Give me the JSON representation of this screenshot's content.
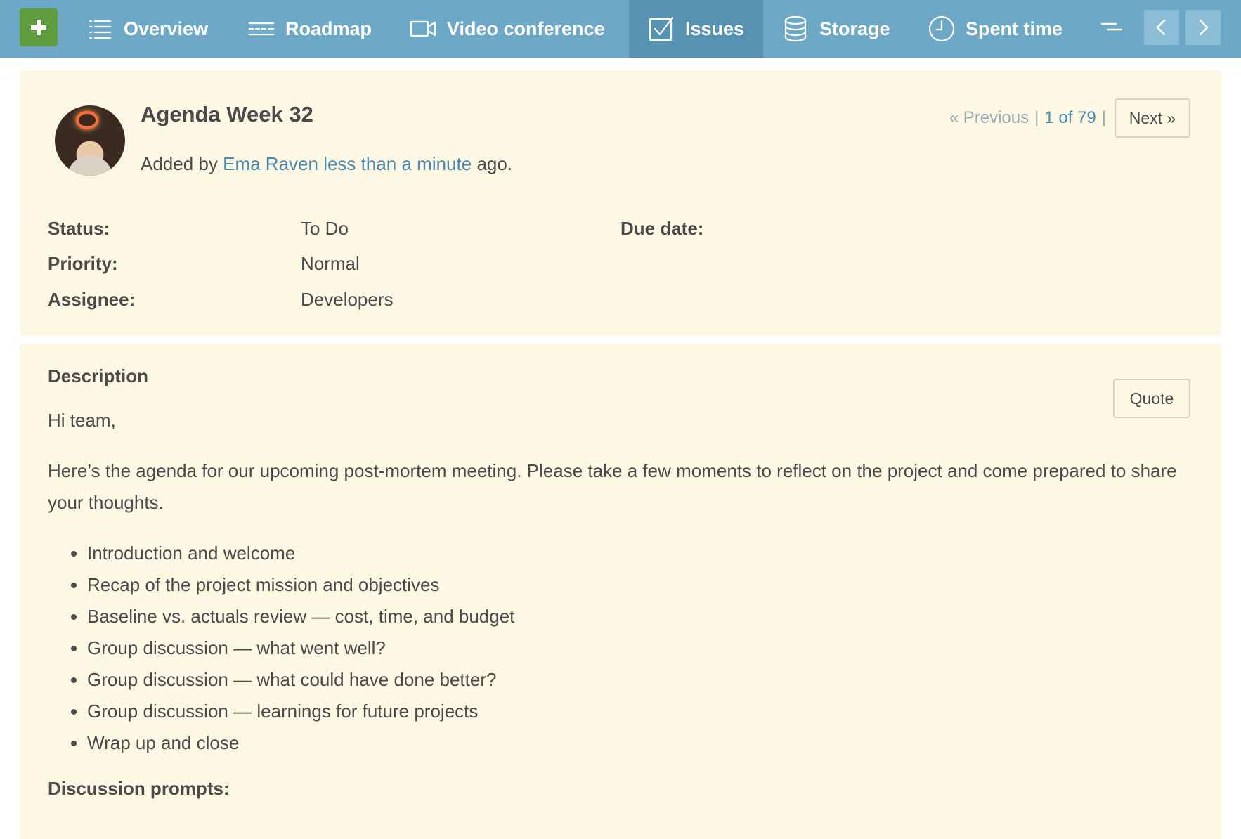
{
  "nav": {
    "new_icon": "plus-icon",
    "items": [
      {
        "label": "Overview",
        "icon": "list-icon",
        "active": false
      },
      {
        "label": "Roadmap",
        "icon": "roadmap-icon",
        "active": false
      },
      {
        "label": "Video conference",
        "icon": "video-camera-icon",
        "active": false
      },
      {
        "label": "Issues",
        "icon": "checkbox-icon",
        "active": true
      },
      {
        "label": "Storage",
        "icon": "database-icon",
        "active": false
      },
      {
        "label": "Spent time",
        "icon": "clock-icon",
        "active": false
      }
    ],
    "more_icon": "menu-more-icon",
    "prev_icon": "chevron-left-icon",
    "next_icon": "chevron-right-icon"
  },
  "issue": {
    "title": "Agenda Week 32",
    "added_prefix": "Added by",
    "author": "Ema Raven",
    "time_ago": "less than a minute",
    "added_suffix": "ago."
  },
  "pager": {
    "previous": "« Previous",
    "separator": "|",
    "position": "1 of 79",
    "next": "Next »"
  },
  "attributes": {
    "status_label": "Status:",
    "status_value": "To Do",
    "priority_label": "Priority:",
    "priority_value": "Normal",
    "assignee_label": "Assignee:",
    "assignee_value": "Developers",
    "due_date_label": "Due date:",
    "due_date_value": ""
  },
  "description": {
    "heading": "Description",
    "quote_button": "Quote",
    "greeting": "Hi team,",
    "intro": "Here’s the agenda for our upcoming post-mortem meeting. Please take a few moments to reflect on the project and come prepared to share your thoughts.",
    "agenda": [
      "Introduction and welcome",
      "Recap of the project mission and objectives",
      "Baseline vs. actuals review — cost, time, and budget",
      "Group discussion — what went well?",
      "Group discussion — what could have done better?",
      "Group discussion — learnings for future projects",
      "Wrap up and close"
    ],
    "prompts_heading": "Discussion prompts:"
  },
  "colors": {
    "nav_bg": "#6ea8c7",
    "nav_active": "#5792b3",
    "new_button": "#5f9d3e",
    "panel_bg": "#fdf8e4",
    "link": "#4a8ab1"
  }
}
